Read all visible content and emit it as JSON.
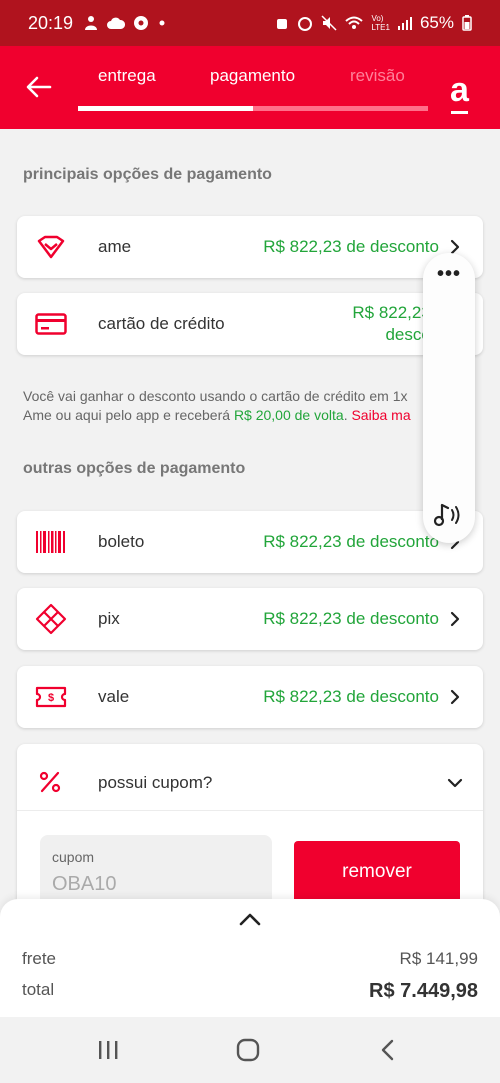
{
  "status_bar": {
    "time": "20:19",
    "network": "LTE1",
    "volte": "Vo)",
    "battery": "65%"
  },
  "header": {
    "steps": [
      "entrega",
      "pagamento",
      "revisão"
    ],
    "active_step": 1,
    "progress": 0.5,
    "brand": "a"
  },
  "main_options": {
    "title": "principais opções de pagamento",
    "items": [
      {
        "label": "ame",
        "discount": "R$ 822,23 de desconto",
        "icon": "heart-icon"
      },
      {
        "label": "cartão de crédito",
        "discount_line1": "R$ 822,23 d",
        "discount_line2": "descont",
        "icon": "credit-card-icon"
      }
    ]
  },
  "info": {
    "line1": "Você vai ganhar o desconto usando o cartão de crédito em 1x",
    "line2_prefix": "Ame ou aqui pelo app e receberá ",
    "cashback": "R$ 20,00 de volta",
    "line2_mid": ". ",
    "link": "Saiba ma"
  },
  "other_options": {
    "title": "outras opções de pagamento",
    "items": [
      {
        "label": "boleto",
        "discount": "R$ 822,23 de desconto",
        "icon": "barcode-icon"
      },
      {
        "label": "pix",
        "discount": "R$ 822,23 de desconto",
        "icon": "pix-icon"
      },
      {
        "label": "vale",
        "discount": "R$ 822,23 de desconto",
        "icon": "voucher-icon"
      }
    ]
  },
  "coupon": {
    "label": "possui cupom?",
    "field_label": "cupom",
    "value": "OBA10",
    "remove_label": "remover"
  },
  "summary": {
    "frete_label": "frete",
    "frete_value": "R$ 141,99",
    "total_label": "total",
    "total_value": "R$ 7.449,98"
  },
  "colors": {
    "brand_red": "#f0002e",
    "status_red": "#b0131e",
    "discount_green": "#22a53a"
  }
}
